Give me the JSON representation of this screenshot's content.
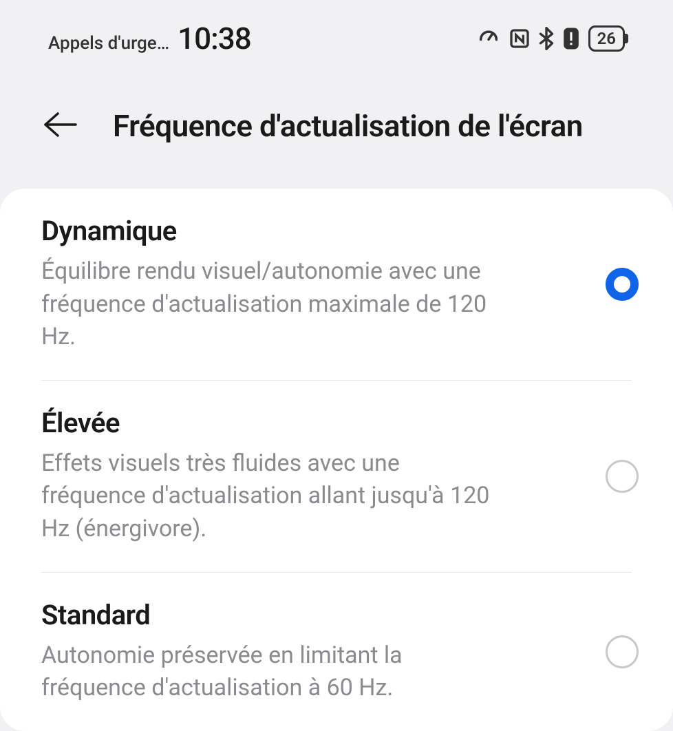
{
  "status_bar": {
    "carrier": "Appels d'urge…",
    "time": "10:38",
    "battery": "26"
  },
  "header": {
    "title": "Fréquence d'actualisation de l'écran"
  },
  "options": [
    {
      "title": "Dynamique",
      "description": "Équilibre rendu visuel/autonomie avec une fréquence d'actualisation maximale de 120 Hz.",
      "selected": true
    },
    {
      "title": "Élevée",
      "description": "Effets visuels très fluides avec une fréquence d'actualisation allant jusqu'à 120 Hz (énergivore).",
      "selected": false
    },
    {
      "title": "Standard",
      "description": "Autonomie préservée en limitant la fréquence d'actualisation à 60 Hz.",
      "selected": false
    }
  ]
}
